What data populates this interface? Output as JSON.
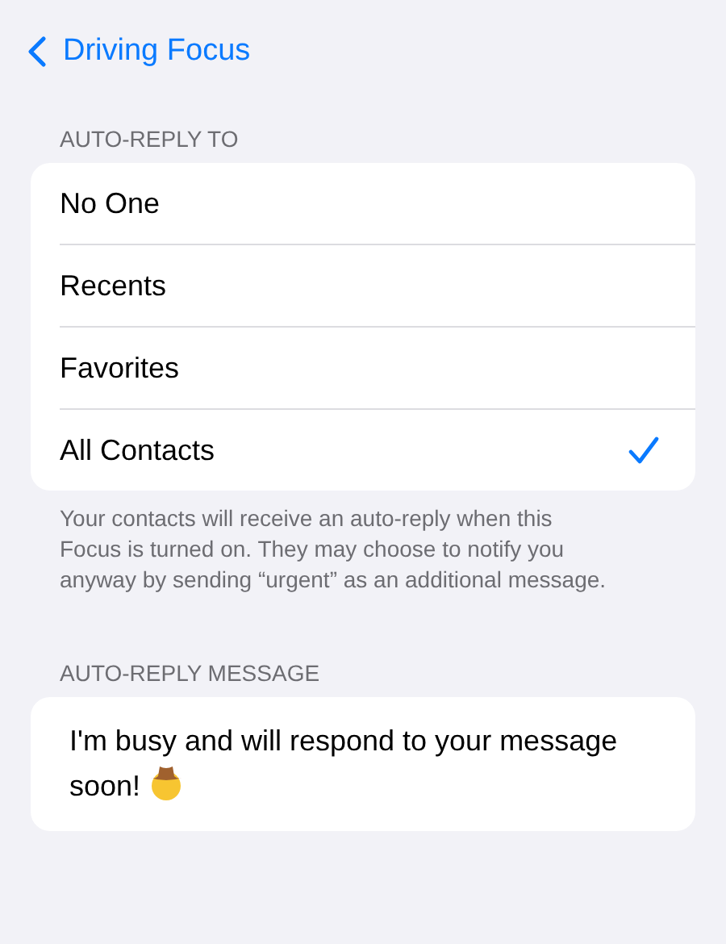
{
  "nav": {
    "back_label": "Driving Focus"
  },
  "reply_section": {
    "header": "AUTO-REPLY TO",
    "options": [
      {
        "label": "No One",
        "selected": false
      },
      {
        "label": "Recents",
        "selected": false
      },
      {
        "label": "Favorites",
        "selected": false
      },
      {
        "label": "All Contacts",
        "selected": true
      }
    ],
    "footer": "Your contacts will receive an auto-reply when this Focus is turned on. They may choose to notify you anyway by sending “urgent” as an additional message."
  },
  "message_section": {
    "header": "AUTO-REPLY MESSAGE",
    "message": "I'm busy and will respond to your message soon!"
  }
}
